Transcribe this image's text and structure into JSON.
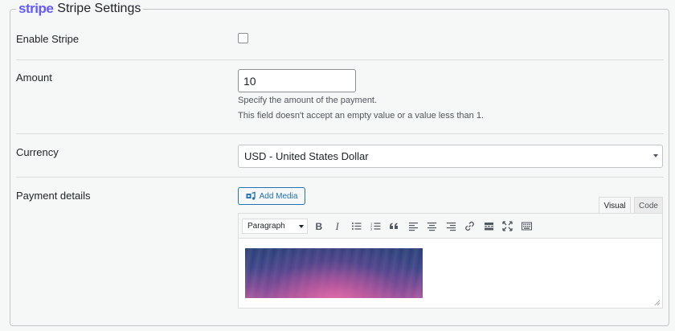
{
  "section": {
    "logo": "stripe",
    "title": "Stripe Settings"
  },
  "fields": {
    "enable": {
      "label": "Enable Stripe",
      "checked": false
    },
    "amount": {
      "label": "Amount",
      "value": "10",
      "description1": "Specify the amount of the payment.",
      "description2": "This field doesn't accept an empty value or a value less than 1."
    },
    "currency": {
      "label": "Currency",
      "selected": "USD - United States Dollar"
    },
    "payment_details": {
      "label": "Payment details",
      "add_media_label": "Add Media",
      "tabs": {
        "visual": "Visual",
        "code": "Code"
      },
      "toolbar": {
        "format": "Paragraph",
        "buttons": [
          "bold",
          "italic",
          "bulleted-list",
          "numbered-list",
          "blockquote",
          "align-left",
          "align-center",
          "align-right",
          "link",
          "read-more",
          "fullscreen",
          "toolbar-toggle"
        ]
      }
    }
  },
  "colors": {
    "brand": "#635bff",
    "accent": "#2271b1"
  }
}
